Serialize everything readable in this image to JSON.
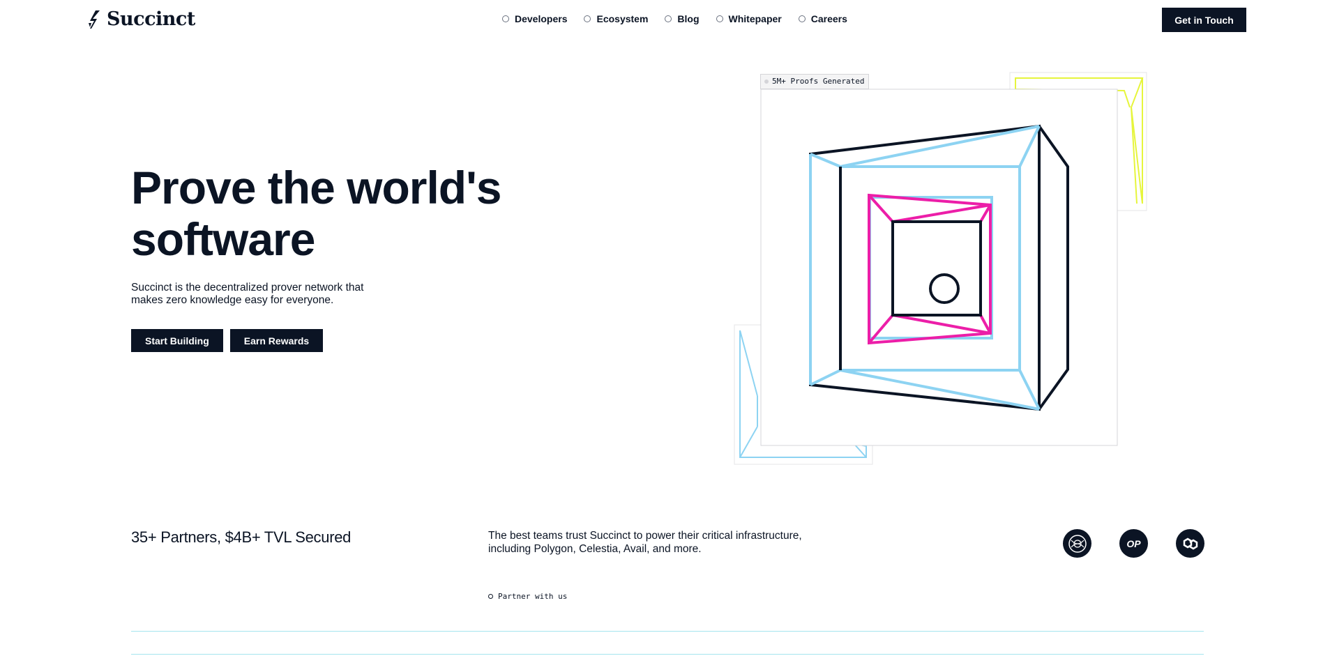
{
  "header": {
    "brand": "Succinct",
    "nav": [
      {
        "label": "Developers"
      },
      {
        "label": "Ecosystem"
      },
      {
        "label": "Blog"
      },
      {
        "label": "Whitepaper"
      },
      {
        "label": "Careers"
      }
    ],
    "cta_label": "Get in Touch"
  },
  "hero": {
    "title_line1": "Prove the world's",
    "title_line2": "software",
    "subtitle": "Succinct is the decentralized prover network that makes zero knowledge easy for everyone.",
    "buttons": [
      {
        "label": "Start Building"
      },
      {
        "label": "Earn Rewards"
      }
    ],
    "badge": "5M+ Proofs Generated"
  },
  "partners": {
    "title": "35+ Partners, $4B+ TVL Secured",
    "description": "The best teams trust Succinct to power their critical infrastructure, including Polygon, Celestia, Avail, and more.",
    "link_label": "Partner with us",
    "logos": [
      {
        "icon": "celestia-logo-icon",
        "text": ""
      },
      {
        "icon": "optimism-logo-icon",
        "text": "OP"
      },
      {
        "icon": "polygon-logo-icon",
        "text": ""
      }
    ]
  },
  "colors": {
    "ink": "#0b1424",
    "cyan": "#8dd3f2",
    "magenta": "#ec1ea8",
    "lime": "#e6f53c"
  }
}
